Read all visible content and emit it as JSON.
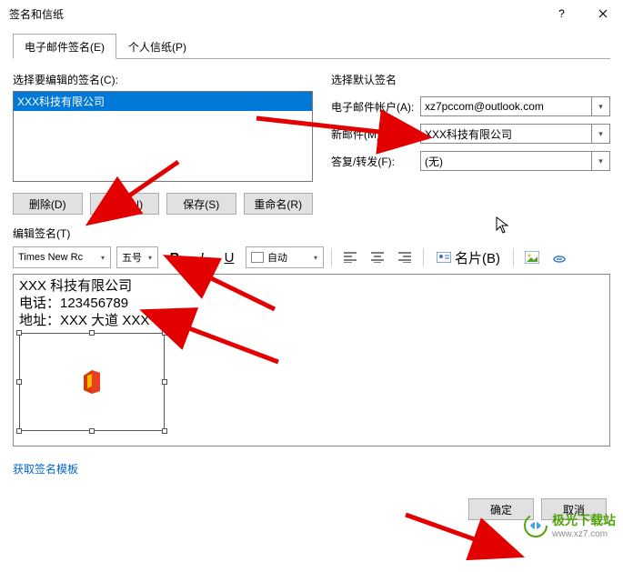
{
  "window": {
    "title": "签名和信纸"
  },
  "tabs": {
    "email_sig": "电子邮件签名(E)",
    "stationery": "个人信纸(P)"
  },
  "left": {
    "choose_label": "选择要编辑的签名(C):",
    "sig_selected": "XXX科技有限公司",
    "btn_delete": "删除(D)",
    "btn_new": "新建(N)",
    "btn_save": "保存(S)",
    "btn_rename": "重命名(R)"
  },
  "right": {
    "defaults_label": "选择默认签名",
    "account_label": "电子邮件帐户(A):",
    "account_value": "xz7pccom@outlook.com",
    "new_msg_label": "新邮件(M):",
    "new_msg_value": "XXX科技有限公司",
    "reply_label": "答复/转发(F):",
    "reply_value": "(无)"
  },
  "edit": {
    "label": "编辑签名(T)",
    "font": "Times New Rc",
    "size": "五号",
    "auto_color": "自动",
    "card_btn": "名片(B)",
    "line1": "XXX 科技有限公司",
    "line2": "电话：123456789",
    "line3": "地址：XXX 大道 XXX"
  },
  "link": {
    "template": "获取签名模板"
  },
  "footer": {
    "ok": "确定",
    "cancel": "取消"
  },
  "watermark": {
    "name": "极光下载站",
    "url": "www.xz7.com"
  }
}
